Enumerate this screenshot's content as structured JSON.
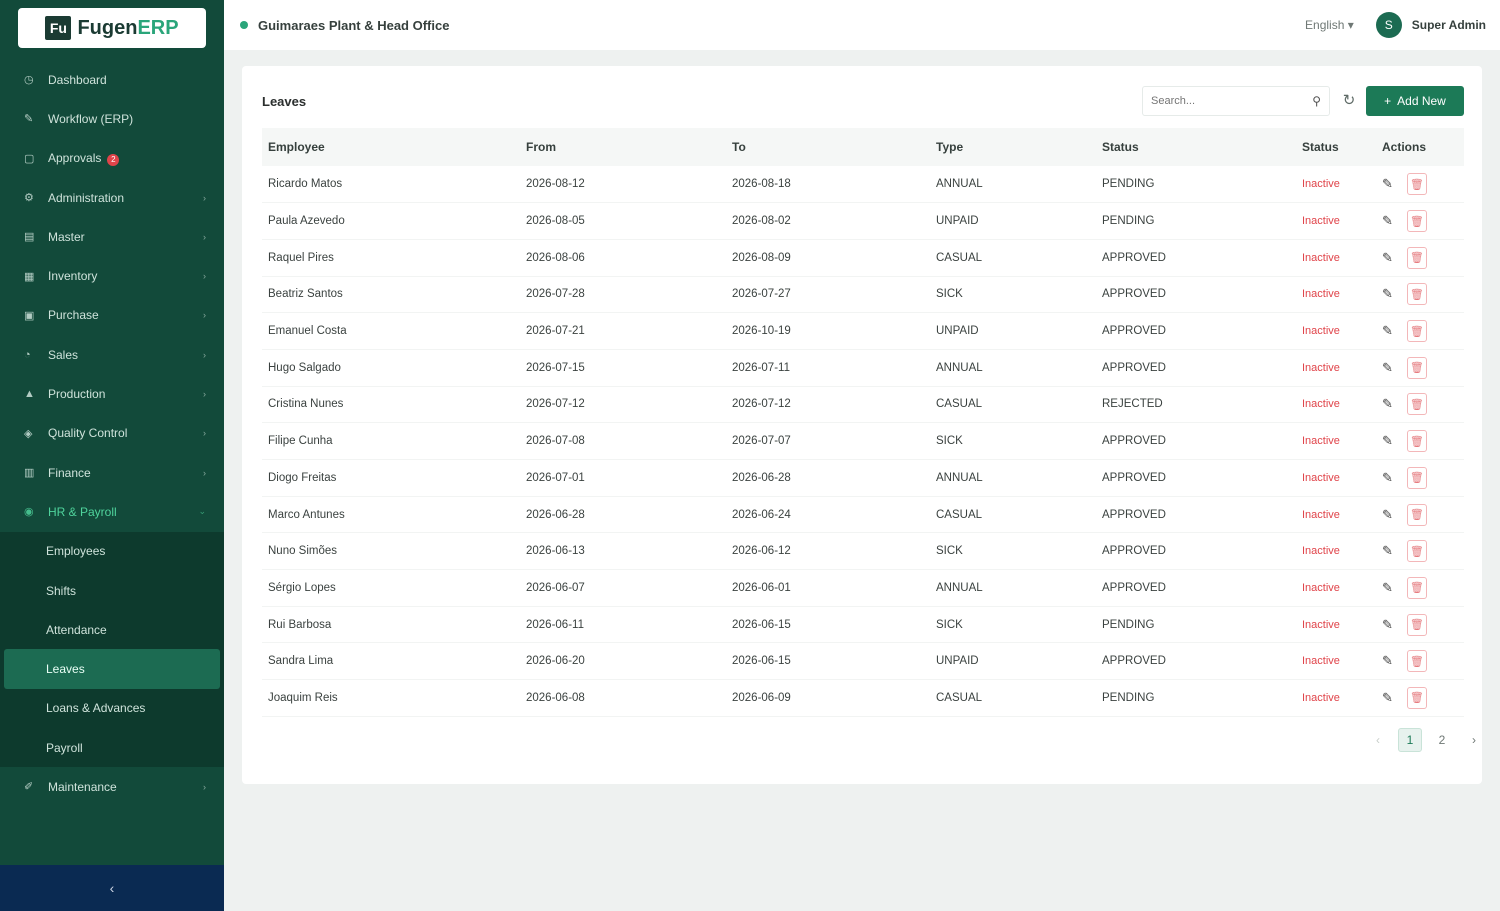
{
  "app": {
    "logo_mark": "Fu",
    "logo_name": "Fugen",
    "logo_suffix": "ERP"
  },
  "header": {
    "location": "Guimaraes Plant & Head Office",
    "language": "English",
    "language_caret": "▾",
    "avatar_initial": "S",
    "user": "Super Admin"
  },
  "sidebar": {
    "items": [
      {
        "label": "Dashboard",
        "icon": "◷",
        "chev": ""
      },
      {
        "label": "Workflow (ERP)",
        "icon": "✎",
        "chev": ""
      },
      {
        "label": "Approvals",
        "icon": "▢",
        "chev": "",
        "badge": "2"
      },
      {
        "label": "Administration",
        "icon": "⚙",
        "chev": "›"
      },
      {
        "label": "Master",
        "icon": "▤",
        "chev": "›"
      },
      {
        "label": "Inventory",
        "icon": "▦",
        "chev": "›"
      },
      {
        "label": "Purchase",
        "icon": "▣",
        "chev": "›"
      },
      {
        "label": "Sales",
        "icon": "◔",
        "chev": "›"
      },
      {
        "label": "Production",
        "icon": "▲",
        "chev": "›"
      },
      {
        "label": "Quality Control",
        "icon": "◈",
        "chev": "›"
      },
      {
        "label": "Finance",
        "icon": "▥",
        "chev": "›"
      },
      {
        "label": "HR & Payroll",
        "icon": "◉",
        "chev": "⌄"
      }
    ],
    "hr_sub": [
      {
        "label": "Employees"
      },
      {
        "label": "Shifts"
      },
      {
        "label": "Attendance"
      },
      {
        "label": "Leaves"
      },
      {
        "label": "Loans & Advances"
      },
      {
        "label": "Payroll"
      }
    ],
    "maintenance": {
      "label": "Maintenance",
      "icon": "✐",
      "chev": "›"
    },
    "collapse": "‹"
  },
  "card": {
    "title": "Leaves",
    "search_placeholder": "Search...",
    "search_icon": "⚲",
    "refresh_icon": "↻",
    "add_icon": "+",
    "add_label": "Add New"
  },
  "table": {
    "columns": [
      "Employee",
      "From",
      "To",
      "Type",
      "Status",
      "Status",
      "Actions"
    ],
    "rows": [
      {
        "employee": "Ricardo Matos",
        "from": "2026-08-12",
        "to": "2026-08-18",
        "type": "ANNUAL",
        "status": "PENDING",
        "tag": "Inactive"
      },
      {
        "employee": "Paula Azevedo",
        "from": "2026-08-05",
        "to": "2026-08-02",
        "type": "UNPAID",
        "status": "PENDING",
        "tag": "Inactive"
      },
      {
        "employee": "Raquel Pires",
        "from": "2026-08-06",
        "to": "2026-08-09",
        "type": "CASUAL",
        "status": "APPROVED",
        "tag": "Inactive"
      },
      {
        "employee": "Beatriz Santos",
        "from": "2026-07-28",
        "to": "2026-07-27",
        "type": "SICK",
        "status": "APPROVED",
        "tag": "Inactive"
      },
      {
        "employee": "Emanuel Costa",
        "from": "2026-07-21",
        "to": "2026-10-19",
        "type": "UNPAID",
        "status": "APPROVED",
        "tag": "Inactive"
      },
      {
        "employee": "Hugo Salgado",
        "from": "2026-07-15",
        "to": "2026-07-11",
        "type": "ANNUAL",
        "status": "APPROVED",
        "tag": "Inactive"
      },
      {
        "employee": "Cristina Nunes",
        "from": "2026-07-12",
        "to": "2026-07-12",
        "type": "CASUAL",
        "status": "REJECTED",
        "tag": "Inactive"
      },
      {
        "employee": "Filipe Cunha",
        "from": "2026-07-08",
        "to": "2026-07-07",
        "type": "SICK",
        "status": "APPROVED",
        "tag": "Inactive"
      },
      {
        "employee": "Diogo Freitas",
        "from": "2026-07-01",
        "to": "2026-06-28",
        "type": "ANNUAL",
        "status": "APPROVED",
        "tag": "Inactive"
      },
      {
        "employee": "Marco Antunes",
        "from": "2026-06-28",
        "to": "2026-06-24",
        "type": "CASUAL",
        "status": "APPROVED",
        "tag": "Inactive"
      },
      {
        "employee": "Nuno Simões",
        "from": "2026-06-13",
        "to": "2026-06-12",
        "type": "SICK",
        "status": "APPROVED",
        "tag": "Inactive"
      },
      {
        "employee": "Sérgio Lopes",
        "from": "2026-06-07",
        "to": "2026-06-01",
        "type": "ANNUAL",
        "status": "APPROVED",
        "tag": "Inactive"
      },
      {
        "employee": "Rui Barbosa",
        "from": "2026-06-11",
        "to": "2026-06-15",
        "type": "SICK",
        "status": "PENDING",
        "tag": "Inactive"
      },
      {
        "employee": "Sandra Lima",
        "from": "2026-06-20",
        "to": "2026-06-15",
        "type": "UNPAID",
        "status": "APPROVED",
        "tag": "Inactive"
      },
      {
        "employee": "Joaquim Reis",
        "from": "2026-06-08",
        "to": "2026-06-09",
        "type": "CASUAL",
        "status": "PENDING",
        "tag": "Inactive"
      }
    ],
    "edit_icon": "✎",
    "delete_icon": "🗑"
  },
  "pagination": {
    "prev": "‹",
    "pages": [
      "1",
      "2"
    ],
    "current": "1",
    "next": "›"
  },
  "colors": {
    "sidebar": "#124a3a",
    "accent": "#1c7a57",
    "danger": "#e0444a"
  }
}
